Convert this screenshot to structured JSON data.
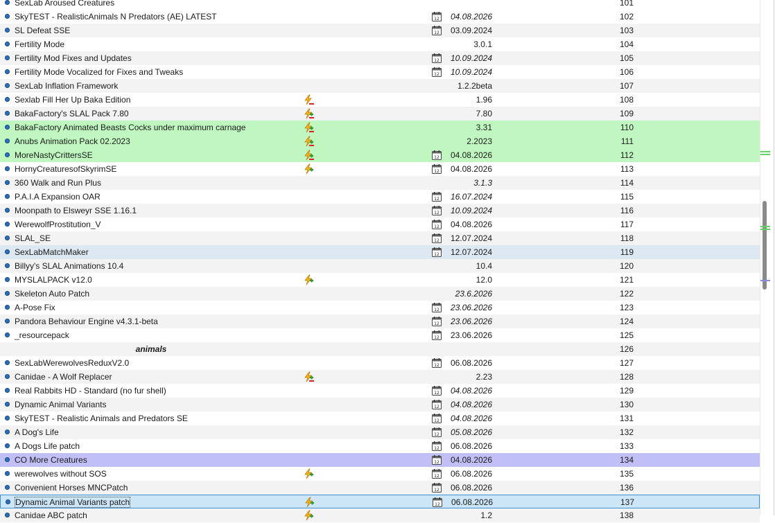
{
  "separator_label": "animals",
  "rows": [
    {
      "name": "SexLab Aroused Creatures",
      "date": false,
      "version": "",
      "ital": false,
      "priority": "101",
      "style": "",
      "flag": ""
    },
    {
      "name": "SkyTEST - RealisticAnimals N Predators (AE) LATEST",
      "date": true,
      "version": "04.08.2026",
      "ital": true,
      "priority": "102",
      "style": "",
      "flag": ""
    },
    {
      "name": "SL Defeat SSE",
      "date": true,
      "version": "03.09.2024",
      "ital": false,
      "priority": "103",
      "style": "alt",
      "flag": ""
    },
    {
      "name": "Fertility Mode",
      "date": false,
      "version": "3.0.1",
      "ital": false,
      "priority": "104",
      "style": "",
      "flag": ""
    },
    {
      "name": "Fertility Mod Fixes and Updates",
      "date": true,
      "version": "10.09.2024",
      "ital": true,
      "priority": "105",
      "style": "alt",
      "flag": ""
    },
    {
      "name": "Fertility Mode Vocalized for Fixes and Tweaks",
      "date": true,
      "version": "10.09.2024",
      "ital": true,
      "priority": "106",
      "style": "",
      "flag": ""
    },
    {
      "name": "SexLab Inflation Framework",
      "date": false,
      "version": "1.2.2beta",
      "ital": false,
      "priority": "107",
      "style": "alt",
      "flag": ""
    },
    {
      "name": "Sexlab Fill Her Up Baka Edition",
      "date": false,
      "version": "1.96",
      "ital": false,
      "priority": "108",
      "style": "",
      "flag": "minus"
    },
    {
      "name": "BakaFactory's SLAL Pack 7.80",
      "date": false,
      "version": "7.80",
      "ital": false,
      "priority": "109",
      "style": "alt",
      "flag": "plusminus"
    },
    {
      "name": "BakaFactory Animated Beasts Cocks under maximum carnage",
      "date": false,
      "version": "3.31",
      "ital": false,
      "priority": "110",
      "style": "green",
      "flag": "plusminus"
    },
    {
      "name": "Anubs Animation Pack 02.2023",
      "date": false,
      "version": "2.2023",
      "ital": false,
      "priority": "111",
      "style": "green",
      "flag": "plusminus"
    },
    {
      "name": "MoreNastyCrittersSE",
      "date": true,
      "version": "04.08.2026",
      "ital": false,
      "priority": "112",
      "style": "green",
      "flag": "plusminus"
    },
    {
      "name": "HornyCreaturesofSkyrimSE",
      "date": true,
      "version": "04.08.2026",
      "ital": false,
      "priority": "113",
      "style": "",
      "flag": "plus"
    },
    {
      "name": "360 Walk and Run Plus",
      "date": false,
      "version": "3.1.3",
      "ital": true,
      "priority": "114",
      "style": "alt",
      "flag": ""
    },
    {
      "name": "P.A.I.A Expansion OAR",
      "date": true,
      "version": "16.07.2024",
      "ital": true,
      "priority": "115",
      "style": "",
      "flag": ""
    },
    {
      "name": "Moonpath to Elsweyr SSE 1.16.1",
      "date": true,
      "version": "10.09.2024",
      "ital": true,
      "priority": "116",
      "style": "alt",
      "flag": ""
    },
    {
      "name": "WerewolfProstitution_V",
      "date": true,
      "version": "04.08.2026",
      "ital": false,
      "priority": "117",
      "style": "",
      "flag": ""
    },
    {
      "name": "SLAL_SE",
      "date": true,
      "version": "12.07.2024",
      "ital": false,
      "priority": "118",
      "style": "alt",
      "flag": ""
    },
    {
      "name": "SexLabMatchMaker",
      "date": true,
      "version": "12.07.2024",
      "ital": false,
      "priority": "119",
      "style": "blue",
      "flag": ""
    },
    {
      "name": "Billyy's SLAL Animations 10.4",
      "date": false,
      "version": "10.4",
      "ital": false,
      "priority": "120",
      "style": "alt",
      "flag": ""
    },
    {
      "name": "MYSLALPACK v12.0",
      "date": false,
      "version": "12.0",
      "ital": false,
      "priority": "121",
      "style": "",
      "flag": "plus"
    },
    {
      "name": "Skeleton Auto Patch",
      "date": false,
      "version": "23.6.2026",
      "ital": true,
      "priority": "122",
      "style": "alt",
      "flag": ""
    },
    {
      "name": "A-Pose Fix",
      "date": true,
      "version": "23.06.2026",
      "ital": true,
      "priority": "123",
      "style": "",
      "flag": ""
    },
    {
      "name": "Pandora Behaviour Engine v4.3.1-beta",
      "date": true,
      "version": "23.06.2026",
      "ital": true,
      "priority": "124",
      "style": "alt",
      "flag": ""
    },
    {
      "name": "_resourcepack",
      "date": true,
      "version": "23.06.2026",
      "ital": false,
      "priority": "125",
      "style": "",
      "flag": ""
    },
    {
      "name": "animals",
      "separator": true,
      "date": false,
      "version": "",
      "ital": false,
      "priority": "126",
      "style": "alt",
      "flag": ""
    },
    {
      "name": "SexLabWerewolvesReduxV2.0",
      "date": true,
      "version": "06.08.2026",
      "ital": false,
      "priority": "127",
      "style": "",
      "flag": ""
    },
    {
      "name": "Canidae - A Wolf Replacer",
      "date": false,
      "version": "2.23",
      "ital": false,
      "priority": "128",
      "style": "alt",
      "flag": "plusminus"
    },
    {
      "name": "Real Rabbits HD - Standard (no fur shell)",
      "date": true,
      "version": "04.08.2026",
      "ital": true,
      "priority": "129",
      "style": "",
      "flag": ""
    },
    {
      "name": "Dynamic Animal Variants",
      "date": true,
      "version": "04.08.2026",
      "ital": true,
      "priority": "130",
      "style": "alt",
      "flag": ""
    },
    {
      "name": "SkyTEST - Realistic Animals and Predators SE",
      "date": true,
      "version": "04.08.2026",
      "ital": true,
      "priority": "131",
      "style": "",
      "flag": ""
    },
    {
      "name": "A Dog's Life",
      "date": true,
      "version": "05.08.2026",
      "ital": true,
      "priority": "132",
      "style": "alt",
      "flag": ""
    },
    {
      "name": "A Dogs Life patch",
      "date": true,
      "version": "06.08.2026",
      "ital": false,
      "priority": "133",
      "style": "",
      "flag": ""
    },
    {
      "name": "CO More Creatures",
      "date": true,
      "version": "04.08.2026",
      "ital": false,
      "priority": "134",
      "style": "purple",
      "flag": ""
    },
    {
      "name": "werewolves without SOS",
      "date": true,
      "version": "06.08.2026",
      "ital": false,
      "priority": "135",
      "style": "",
      "flag": "plus"
    },
    {
      "name": "Convenient Horses MNCPatch",
      "date": true,
      "version": "06.08.2026",
      "ital": false,
      "priority": "136",
      "style": "alt",
      "flag": ""
    },
    {
      "name": "Dynamic Animal Variants patch",
      "date": true,
      "version": "06.08.2026",
      "ital": false,
      "priority": "137",
      "style": "selected",
      "flag": "plus"
    },
    {
      "name": "Canidae ABC patch",
      "date": false,
      "version": "1.2",
      "ital": false,
      "priority": "138",
      "style": "alt",
      "flag": "plus"
    }
  ],
  "colors": {
    "accent": "#3d8fd6",
    "green_row": "#c0f7c0",
    "purple_row": "#c0c0f6",
    "blue_row": "#dde8f2"
  }
}
